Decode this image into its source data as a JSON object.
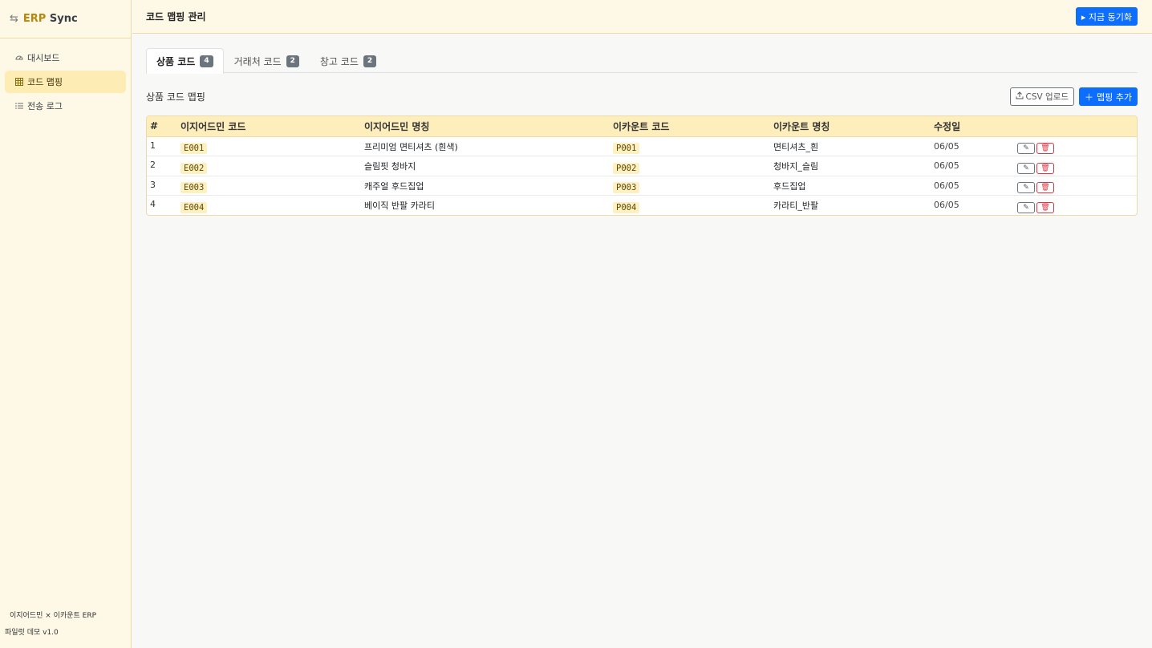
{
  "app": {
    "brand_erp": "ERP",
    "brand_sync": "Sync",
    "brand_icon": "swap-arrows-icon"
  },
  "sidebar": {
    "items": [
      {
        "label": "대시보드",
        "icon": "gauge-icon"
      },
      {
        "label": "코드 맵핑",
        "icon": "table-icon",
        "active": true
      },
      {
        "label": "전송 로그",
        "icon": "list-icon"
      }
    ],
    "footer_line1": "이지어드민 × 이카운트 ERP",
    "footer_line2": "파일럿 데모 v1.0"
  },
  "header": {
    "title": "코드 맵핑 관리",
    "sync_button": "▸ 지금 동기화"
  },
  "tabs": [
    {
      "label": "상품 코드",
      "count": "4",
      "active": true
    },
    {
      "label": "거래처 코드",
      "count": "2"
    },
    {
      "label": "창고 코드",
      "count": "2"
    }
  ],
  "section": {
    "title": "상품 코드 맵핑",
    "csv_button": "CSV 업로드",
    "add_button": "맵핑 추가"
  },
  "table": {
    "headers": [
      "#",
      "이지어드민 코드",
      "이지어드민 명칭",
      "이카운트 코드",
      "이카운트 명칭",
      "수정일"
    ],
    "rows": [
      {
        "no": "1",
        "ez_code": "E001",
        "ez_name": "프리미엄 면티셔츠 (흰색)",
        "ec_code": "P001",
        "ec_name": "면티셔츠_흰",
        "date": "06/05"
      },
      {
        "no": "2",
        "ez_code": "E002",
        "ez_name": "슬림핏 청바지",
        "ec_code": "P002",
        "ec_name": "청바지_슬림",
        "date": "06/05"
      },
      {
        "no": "3",
        "ez_code": "E003",
        "ez_name": "캐주얼 후드집업",
        "ec_code": "P003",
        "ec_name": "후드집업",
        "date": "06/05"
      },
      {
        "no": "4",
        "ez_code": "E004",
        "ez_name": "베이직 반팔 카라티",
        "ec_code": "P004",
        "ec_name": "카라티_반팔",
        "date": "06/05"
      }
    ]
  },
  "colors": {
    "accent": "#0d6efd",
    "sidebar_bg": "#fef9e7",
    "header_row": "#fdeebc",
    "danger": "#dc3545"
  }
}
